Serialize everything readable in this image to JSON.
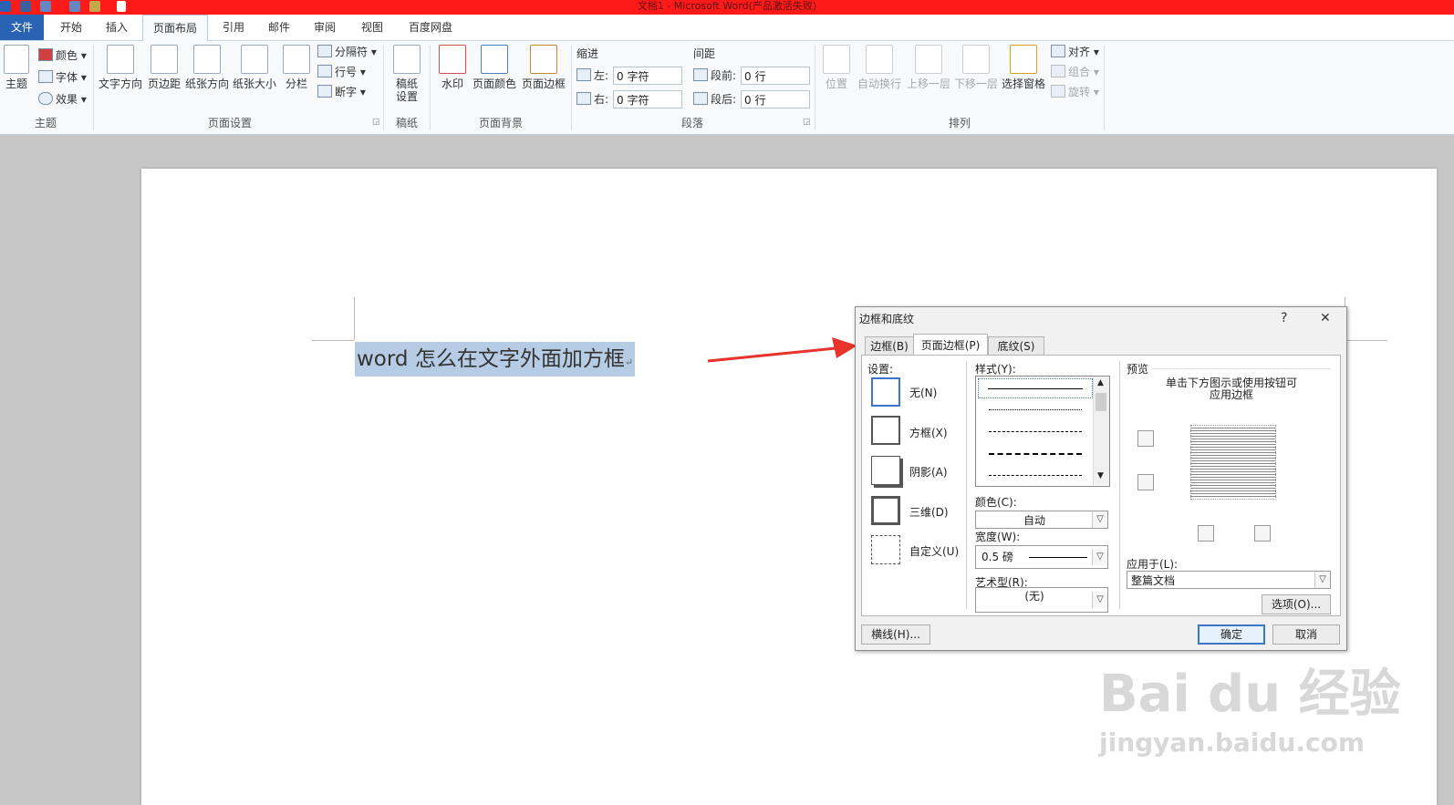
{
  "app": {
    "window_title": "文档1 - Microsoft Word(产品激活失败)"
  },
  "ribbon_tabs": [
    "文件",
    "开始",
    "插入",
    "页面布局",
    "引用",
    "邮件",
    "审阅",
    "视图",
    "百度网盘"
  ],
  "ribbon": {
    "theme_group": {
      "label": "主题",
      "theme": "主题",
      "colors": "颜色",
      "fonts": "字体",
      "effects": "效果"
    },
    "page_setup_group": {
      "label": "页面设置",
      "text_direction": "文字方向",
      "margins": "页边距",
      "orientation": "纸张方向",
      "size": "纸张大小",
      "columns": "分栏",
      "breaks": "分隔符",
      "line_numbers": "行号",
      "hyphenation": "断字"
    },
    "manuscript_group": {
      "label": "稿纸",
      "manuscript_settings": "稿纸\n设置"
    },
    "page_background_group": {
      "label": "页面背景",
      "watermark": "水印",
      "page_color": "页面颜色",
      "page_borders": "页面边框"
    },
    "paragraph_group": {
      "label": "段落",
      "indent_label": "缩进",
      "indent_left_label": "左:",
      "indent_left_value": "0 字符",
      "indent_right_label": "右:",
      "indent_right_value": "0 字符",
      "spacing_label": "间距",
      "spacing_before_label": "段前:",
      "spacing_before_value": "0 行",
      "spacing_after_label": "段后:",
      "spacing_after_value": "0 行"
    },
    "arrange_group": {
      "label": "排列",
      "position": "位置",
      "wrap_text": "自动换行",
      "bring_forward": "上移一层",
      "send_backward": "下移一层",
      "selection_pane": "选择窗格",
      "align": "对齐",
      "group": "组合",
      "rotate": "旋转"
    }
  },
  "document": {
    "text_en": "word",
    "text_zh": " 怎么在文字外面加方框",
    "paragraph_mark": "↵"
  },
  "dialog": {
    "title": "边框和底纹",
    "help": "?",
    "close": "✕",
    "tabs": [
      "边框(B)",
      "页面边框(P)",
      "底纹(S)"
    ],
    "settings_label": "设置:",
    "settings": [
      "无(N)",
      "方框(X)",
      "阴影(A)",
      "三维(D)",
      "自定义(U)"
    ],
    "style_label": "样式(Y):",
    "color_label": "颜色(C):",
    "color_value": "自动",
    "width_label": "宽度(W):",
    "width_value": "0.5 磅",
    "art_label": "艺术型(R):",
    "art_value": "(无)",
    "preview_label": "预览",
    "preview_hint": "单击下方图示或使用按钮可应用边框",
    "apply_to_label": "应用于(L):",
    "apply_to_value": "整篇文档",
    "options_button": "选项(O)...",
    "horizontal_line_button": "横线(H)...",
    "ok_button": "确定",
    "cancel_button": "取消"
  },
  "watermark": {
    "brand": "Bai du 经验",
    "url": "jingyan.baidu.com"
  },
  "colors": {
    "title_bar": "#ff1a1a",
    "file_tab": "#2a62b3",
    "selection": "#b6cbe4",
    "arrow": "#e8332b"
  }
}
